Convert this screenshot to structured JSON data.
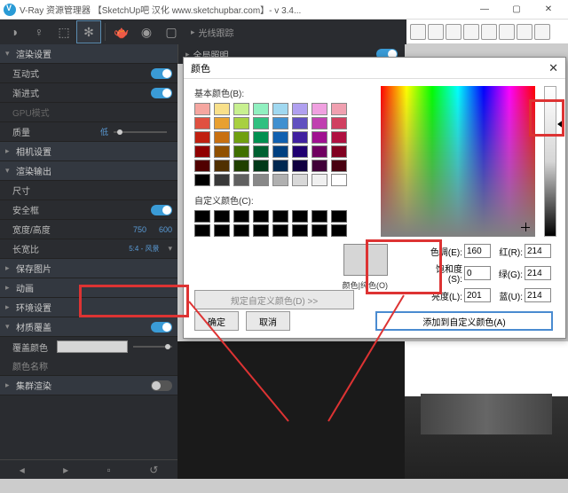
{
  "window": {
    "title": "V-Ray 资源管理器 【SketchUp吧 汉化 www.sketchupbar.com】- v 3.4...",
    "minimize": "—",
    "restore": "▢",
    "close": "✕"
  },
  "right_settings_header1": "光线跟踪",
  "right_settings_header2": "全局照明",
  "left": {
    "section_render": "渲染设置",
    "row_interactive": "互动式",
    "row_progressive": "渐进式",
    "row_gpu": "GPU模式",
    "row_quality": "质量",
    "row_quality_val": "低",
    "section_camera": "相机设置",
    "section_output": "渲染输出",
    "row_size": "尺寸",
    "row_safe": "安全框",
    "row_wh": "宽度/高度",
    "row_wh_w": "750",
    "row_wh_h": "600",
    "row_aspect": "长宽比",
    "row_aspect_val": "5:4 - 风景",
    "section_save": "保存图片",
    "section_anim": "动画",
    "section_env": "环境设置",
    "section_mat": "材质覆盖",
    "row_override_color": "覆盖颜色",
    "row_override_name": "颜色名称",
    "section_swarm": "集群渲染"
  },
  "dialog": {
    "title": "颜色",
    "basic_label": "基本颜色(B):",
    "custom_label": "自定义颜色(C):",
    "define_btn": "规定自定义颜色(D) >>",
    "ok": "确定",
    "cancel": "取消",
    "add": "添加到自定义颜色(A)",
    "solid_label": "颜色|纯色(O)",
    "hue_label": "色调(E):",
    "hue_val": "160",
    "sat_label": "饱和度(S):",
    "sat_val": "0",
    "lum_label": "亮度(L):",
    "lum_val": "201",
    "r_label": "红(R):",
    "r_val": "214",
    "g_label": "绿(G):",
    "g_val": "214",
    "b_label": "蓝(U):",
    "b_val": "214"
  },
  "basic_colors": [
    "#f5a6a0",
    "#f8e08a",
    "#c8f090",
    "#90f0c0",
    "#a0d8f0",
    "#b0a0f0",
    "#f0a0e0",
    "#f0a0b0",
    "#e05040",
    "#e8a030",
    "#a8d040",
    "#30c080",
    "#4090d0",
    "#6050c0",
    "#c040b0",
    "#d04060",
    "#c02010",
    "#c87010",
    "#70a010",
    "#009050",
    "#1060b0",
    "#4020a0",
    "#a01090",
    "#b01040",
    "#900000",
    "#905000",
    "#407000",
    "#006030",
    "#004080",
    "#200070",
    "#700060",
    "#800020",
    "#500000",
    "#503000",
    "#204000",
    "#003818",
    "#002850",
    "#100040",
    "#400038",
    "#480010",
    "#000000",
    "#383838",
    "#606060",
    "#888888",
    "#b0b0b0",
    "#d8d8d8",
    "#f0f0f0",
    "#ffffff"
  ]
}
